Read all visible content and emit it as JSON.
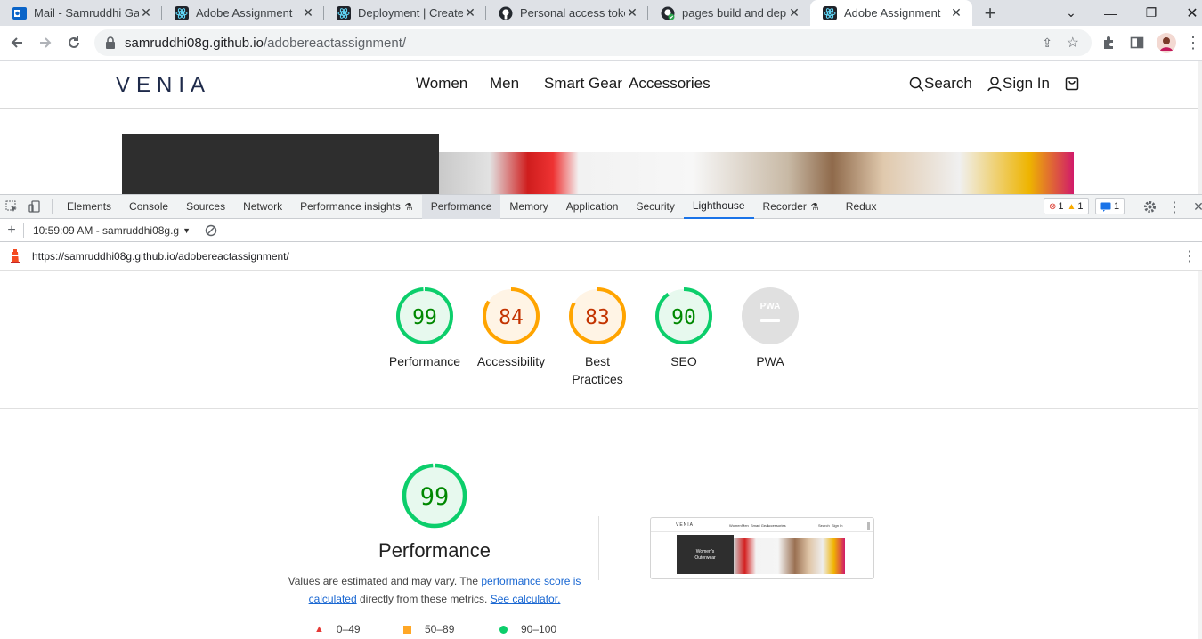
{
  "browser": {
    "tabs": [
      {
        "title": "Mail - Samruddhi Gad",
        "icon": "outlook-icon",
        "active": false
      },
      {
        "title": "Adobe Assignment",
        "icon": "react-icon",
        "active": false
      },
      {
        "title": "Deployment | Create R",
        "icon": "react-icon",
        "active": false
      },
      {
        "title": "Personal access token",
        "icon": "github-icon",
        "active": false
      },
      {
        "title": "pages build and deplo",
        "icon": "github-actions-icon",
        "active": false
      },
      {
        "title": "Adobe Assignment",
        "icon": "react-icon",
        "active": true
      }
    ],
    "url_host": "samruddhi08g.github.io",
    "url_path": "/adobereactassignment/"
  },
  "site": {
    "logo": "VENIA",
    "nav": [
      "Women",
      "Men",
      "Smart Gear",
      "Accessories"
    ],
    "search_label": "Search",
    "signin_label": "Sign In"
  },
  "devtools": {
    "tabs": [
      "Elements",
      "Console",
      "Sources",
      "Network",
      "Performance insights",
      "Performance",
      "Memory",
      "Application",
      "Security",
      "Lighthouse",
      "Recorder",
      "Redux"
    ],
    "errors": "1",
    "warnings": "1",
    "messages": "1",
    "report_select": "10:59:09 AM - samruddhi08g.g",
    "audited_url": "https://samruddhi08g.github.io/adobereactassignment/"
  },
  "lighthouse": {
    "gauges": [
      {
        "label": "Performance",
        "score": "99",
        "status": "pass"
      },
      {
        "label": "Accessibility",
        "score": "84",
        "status": "average"
      },
      {
        "label": "Best Practices",
        "score": "83",
        "status": "average"
      },
      {
        "label": "SEO",
        "score": "90",
        "status": "pass"
      },
      {
        "label": "PWA",
        "score": "",
        "status": "na"
      }
    ],
    "main_score": "99",
    "main_title": "Performance",
    "desc_pre": "Values are estimated and may vary. The ",
    "desc_link1": "performance score is calculated",
    "desc_mid": " directly from these metrics. ",
    "desc_link2": "See calculator.",
    "legend": [
      {
        "range": "0–49",
        "color": "#e53935"
      },
      {
        "range": "50–89",
        "color": "#ffa726"
      },
      {
        "range": "90–100",
        "color": "#0cce6b"
      }
    ],
    "colors": {
      "pass": "#0cce6b",
      "pass_text": "#008800",
      "average": "#ffa400",
      "average_text": "#c33300",
      "na": "#e0e0e0"
    }
  },
  "thumbnail": {
    "logo": "VENIA",
    "nav": [
      "Women",
      "Men",
      "Smart Gear",
      "Accessories"
    ],
    "search": "Search",
    "signin": "Sign In",
    "hero_line1": "Women's",
    "hero_line2": "Outerwear"
  }
}
